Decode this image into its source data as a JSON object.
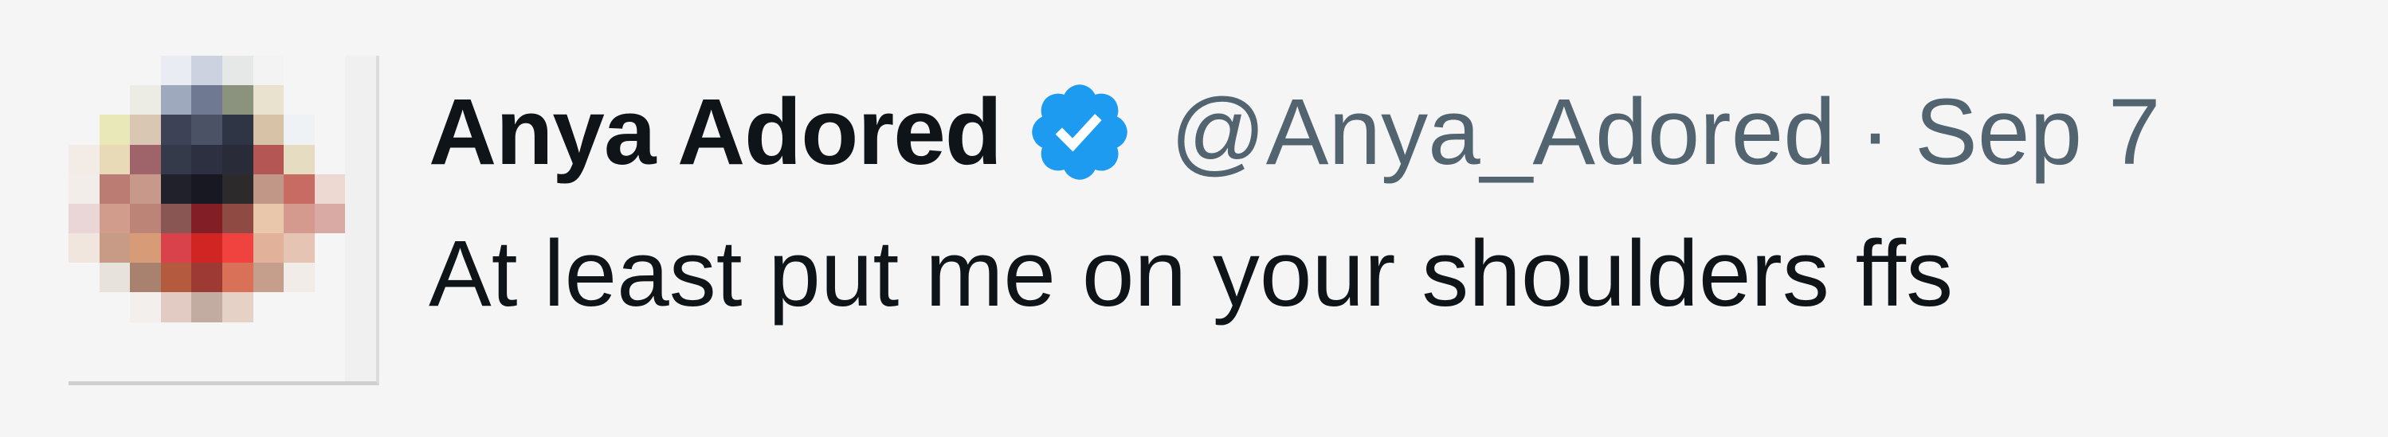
{
  "tweet": {
    "author": {
      "name": "Anya Adored",
      "handle": "@Anya_Adored",
      "verified": true,
      "badge_icon": "verified-badge-icon",
      "badge_color": "#1d9bf0"
    },
    "separator": "·",
    "date": "Sep 7",
    "text": "At least put me on your shoulders ffs"
  },
  "avatar": {
    "icon": "pixelated-avatar-image",
    "pixels": [
      [
        "#f5f5f5",
        "#f5f5f5",
        "#f5f5f5",
        "#e9ecf2",
        "#cdd2e0",
        "#e6e8e7",
        "#f3f3f3",
        "#f5f5f5",
        "#f5f5f5",
        "#f0f0f0"
      ],
      [
        "#f5f5f5",
        "#f5f5f5",
        "#ecebe4",
        "#9fa9be",
        "#6f7a92",
        "#8b927e",
        "#e8e2cf",
        "#f5f5f5",
        "#f5f5f5",
        "#f0f0f0"
      ],
      [
        "#f5f5f5",
        "#e9e8b9",
        "#d9c7b4",
        "#3d4257",
        "#4c5266",
        "#303545",
        "#d8c2a7",
        "#eef2f5",
        "#f5f5f5",
        "#f0f0f0"
      ],
      [
        "#f3ece6",
        "#e8dab6",
        "#9e6469",
        "#353a4a",
        "#2d3040",
        "#292c38",
        "#b45653",
        "#e6dcc2",
        "#f5f5f5",
        "#f0f0f0"
      ],
      [
        "#f2ede8",
        "#bb7c73",
        "#c8998b",
        "#21212c",
        "#171821",
        "#2d2a2c",
        "#c19888",
        "#c86c63",
        "#eed8d2",
        "#f0f0f0"
      ],
      [
        "#ead6d6",
        "#d19c8c",
        "#bc8477",
        "#8a5653",
        "#821e26",
        "#904a44",
        "#e9c7ab",
        "#d49a8d",
        "#d9a9a3",
        "#f0f0f0"
      ],
      [
        "#f1e6de",
        "#c79b85",
        "#d89b78",
        "#d9424b",
        "#d12524",
        "#f0433f",
        "#e1b199",
        "#e6c4b3",
        "#f5f5f5",
        "#f0f0f0"
      ],
      [
        "#f5f5f5",
        "#e7e2dc",
        "#a8826f",
        "#b45b3f",
        "#9c3a33",
        "#d97159",
        "#c59f8c",
        "#f2ece9",
        "#f5f5f5",
        "#f0f0f0"
      ],
      [
        "#f5f5f5",
        "#f5f5f5",
        "#f3efec",
        "#e1cbc2",
        "#c2aba0",
        "#e5d1c6",
        "#f5f5f5",
        "#f5f5f5",
        "#f5f5f5",
        "#f0f0f0"
      ],
      [
        "#f5f5f5",
        "#f5f5f5",
        "#f5f5f5",
        "#f5f5f5",
        "#f5f5f5",
        "#f5f5f5",
        "#f5f5f5",
        "#f5f5f5",
        "#f5f5f5",
        "#f0f0f0"
      ],
      [
        "#f5f5f5",
        "#f5f5f5",
        "#f5f5f5",
        "#f5f5f5",
        "#f5f5f5",
        "#f5f5f5",
        "#f5f5f5",
        "#f5f5f5",
        "#f5f5f5",
        "#f0f0f0"
      ]
    ]
  }
}
